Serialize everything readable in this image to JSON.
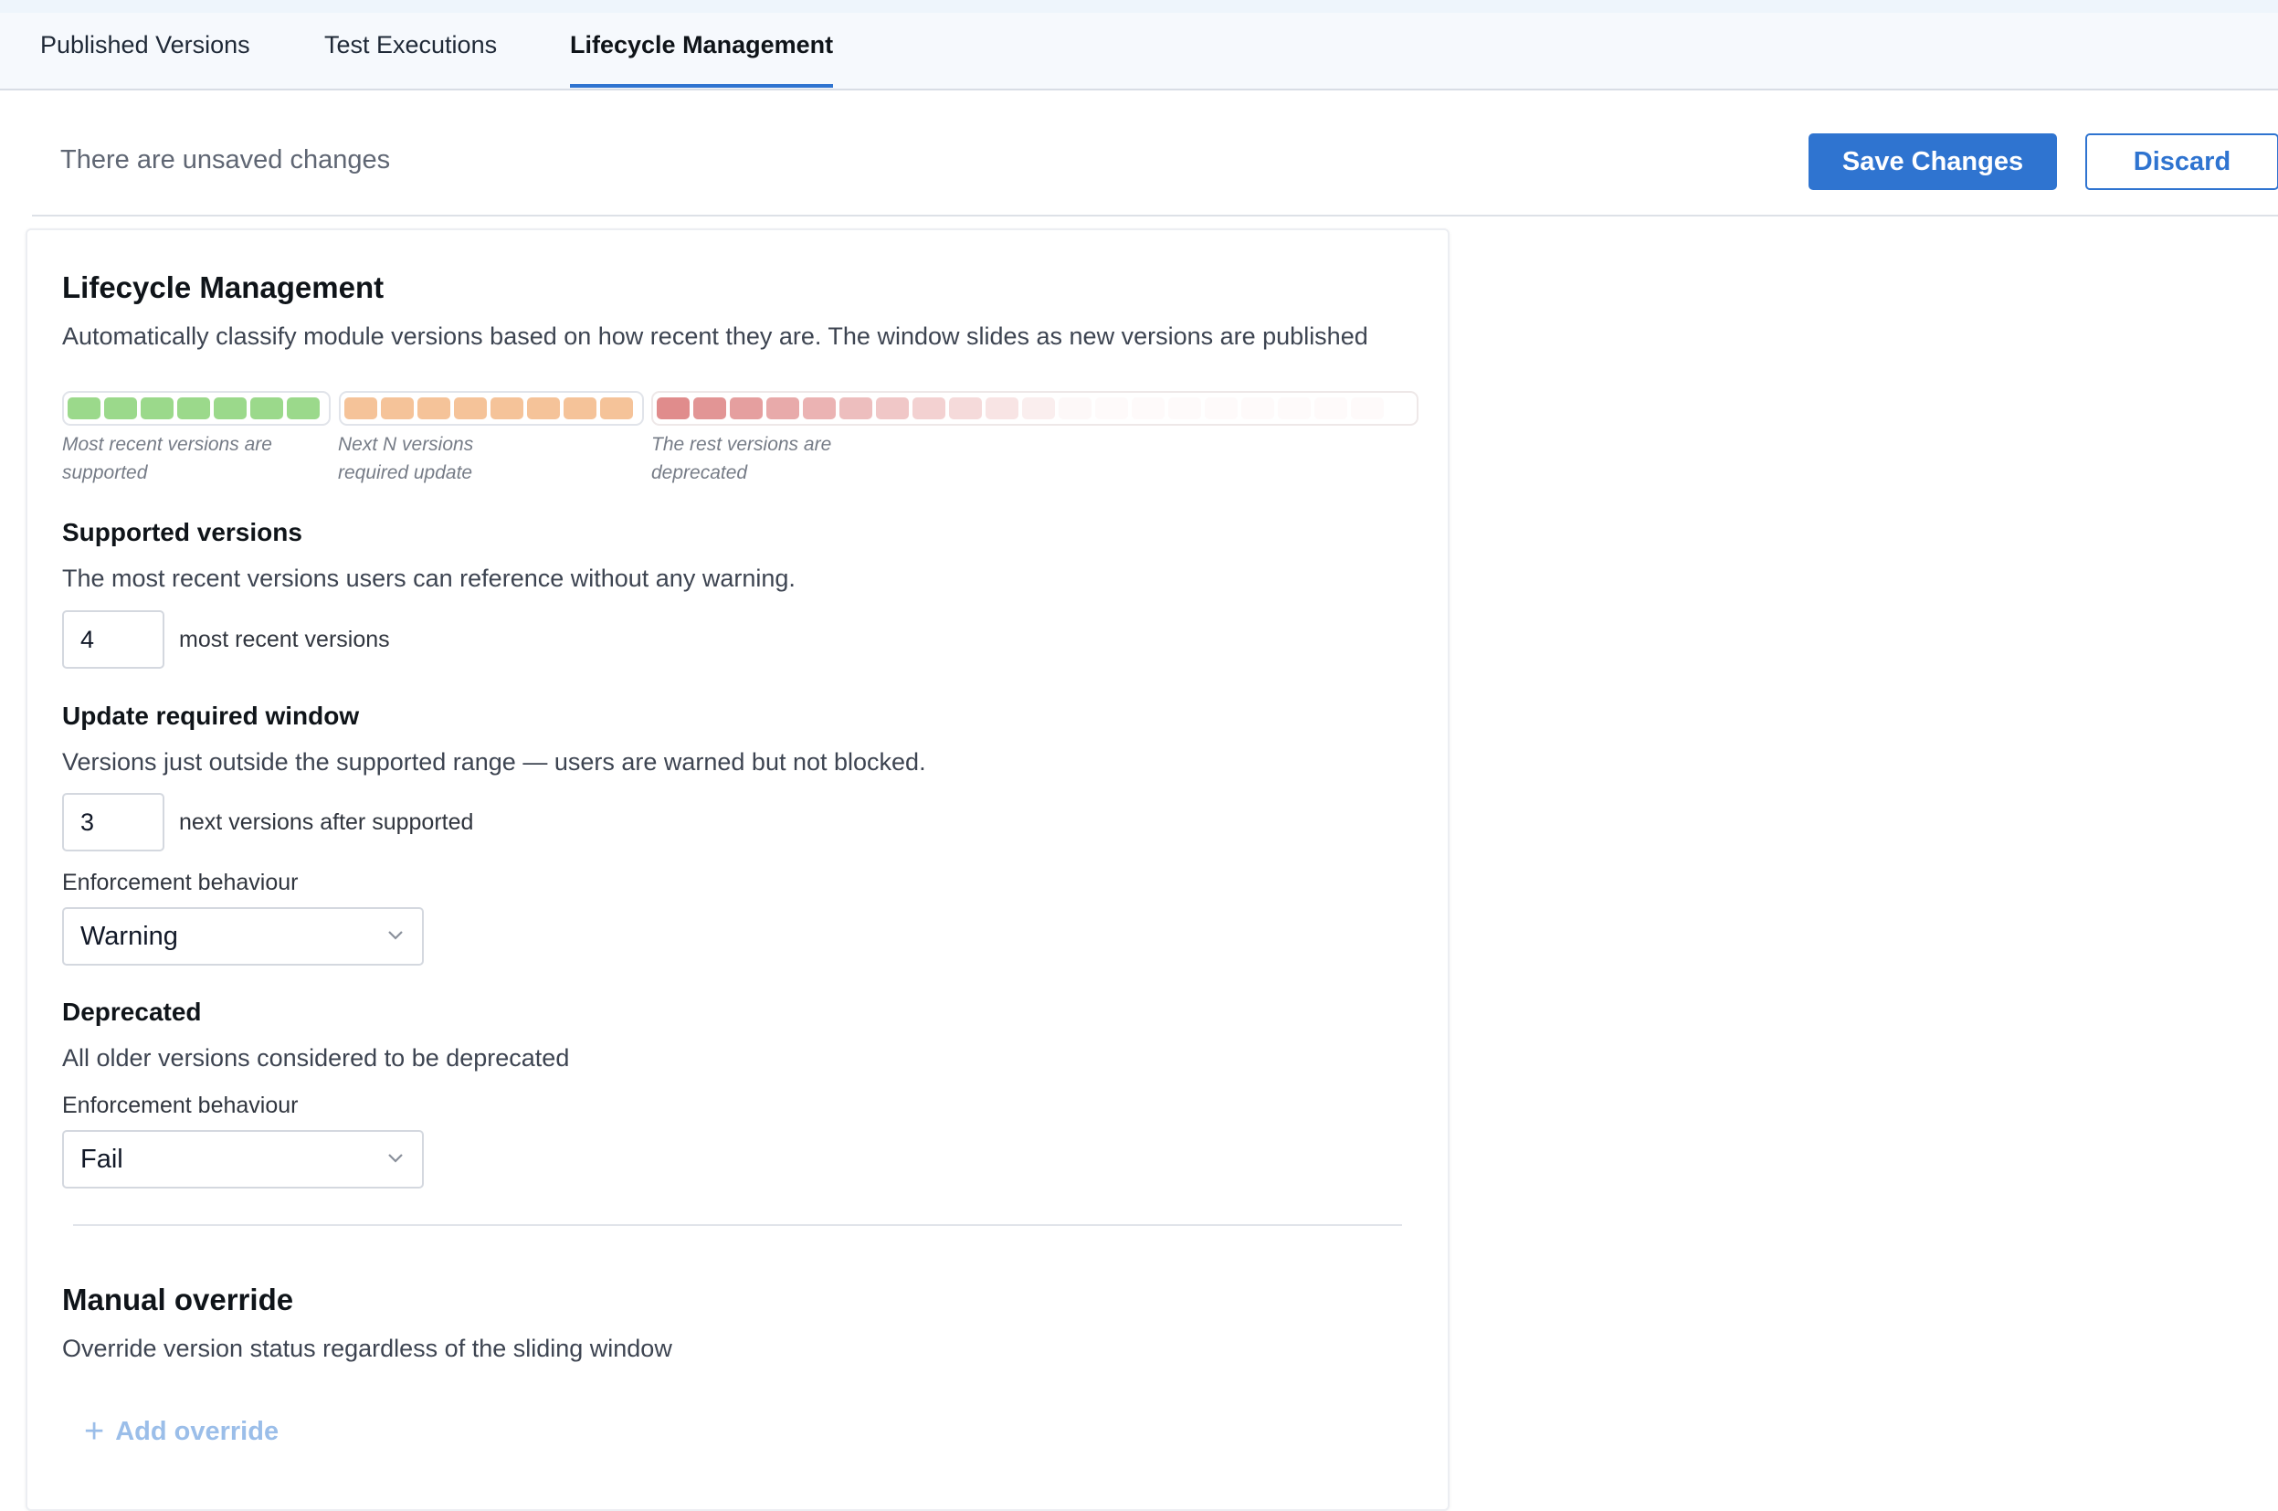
{
  "tabs": [
    {
      "label": "Published Versions",
      "active": false
    },
    {
      "label": "Test Executions",
      "active": false
    },
    {
      "label": "Lifecycle Management",
      "active": true
    }
  ],
  "unsaved": {
    "message": "There are unsaved changes",
    "save_label": "Save Changes",
    "discard_label": "Discard"
  },
  "lifecycle": {
    "title": "Lifecycle Management",
    "description": "Automatically classify module versions based on how recent they are. The window slides as new versions are published",
    "window_legend": {
      "supported_caption": "Most recent versions are supported",
      "update_caption": "Next N versions required update",
      "deprecated_caption": "The rest versions are deprecated"
    },
    "colors": {
      "supported": "#9bd98b",
      "update": "#f5c399",
      "deprecated": "#e08c8c",
      "accent": "#2f74d0"
    }
  },
  "supported": {
    "title": "Supported versions",
    "description": "The most recent versions users can reference without any warning.",
    "value": "4",
    "suffix": "most recent versions"
  },
  "update_window": {
    "title": "Update required window",
    "description": "Versions just outside the supported range — users are warned but not blocked.",
    "value": "3",
    "suffix": "next versions after supported",
    "enforcement_label": "Enforcement behaviour",
    "enforcement_value": "Warning"
  },
  "deprecated": {
    "title": "Deprecated",
    "description": "All older versions considered to be deprecated",
    "enforcement_label": "Enforcement behaviour",
    "enforcement_value": "Fail"
  },
  "manual_override": {
    "title": "Manual override",
    "description": "Override version status regardless of the sliding window",
    "add_label": "Add override"
  }
}
